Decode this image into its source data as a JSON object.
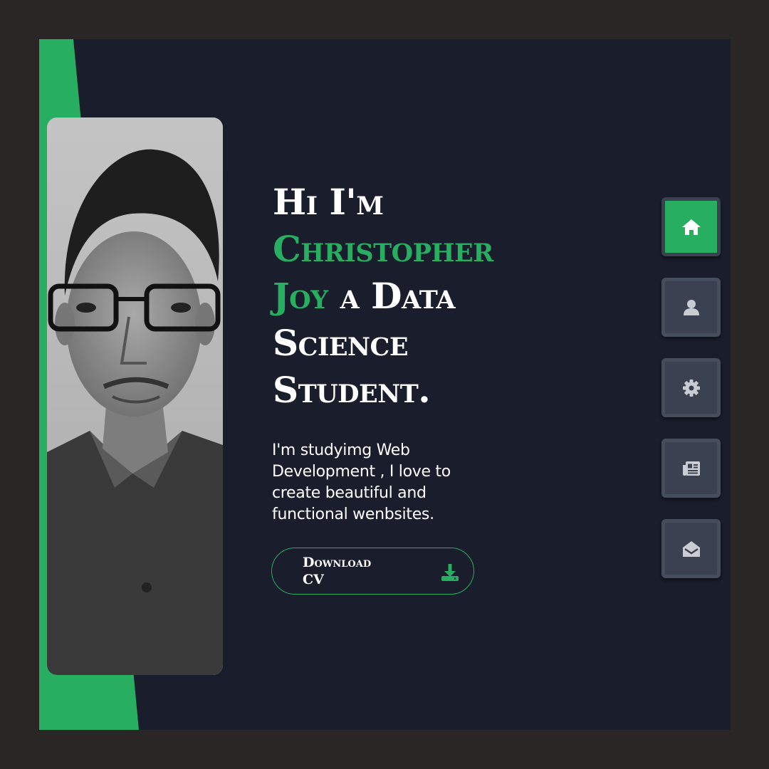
{
  "hero": {
    "greeting": "Hi I'm",
    "name": "Christopher Joy",
    "role": "a Data Science Student",
    "dot": "."
  },
  "intro": {
    "text": "I'm studyimg Web Development , I love to create beautiful and functional wenbsites."
  },
  "cv_button": {
    "label": "Download CV",
    "icon": "download-icon"
  },
  "nav": {
    "items": [
      {
        "name": "home",
        "icon": "home-icon",
        "active": true
      },
      {
        "name": "about",
        "icon": "user-icon",
        "active": false
      },
      {
        "name": "services",
        "icon": "gear-icon",
        "active": false
      },
      {
        "name": "blog",
        "icon": "newspaper-icon",
        "active": false
      },
      {
        "name": "contact",
        "icon": "envelope-open-icon",
        "active": false
      }
    ]
  },
  "colors": {
    "accent": "#27ae60",
    "background": "#1a1d2b",
    "outer": "#2a2626",
    "nav_button": "#3b4150"
  }
}
